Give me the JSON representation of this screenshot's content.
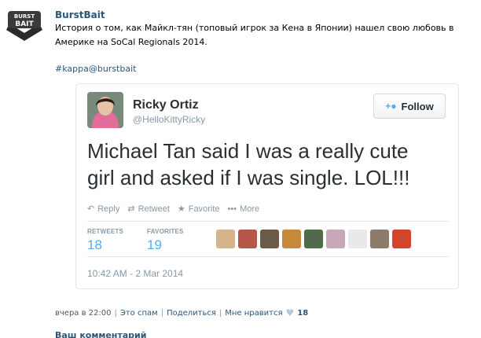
{
  "post": {
    "author": "BurstBait",
    "text": "История о том, как Майкл-тян (топовый игрок за Кена в Японии) нашел свою любовь в Америке на SoCal Regionals 2014.",
    "hashtag": "#kappa@burstbait",
    "logo_text": "BURST BAIT"
  },
  "tweet": {
    "name": "Ricky Ortiz",
    "handle": "@HelloKittyRicky",
    "follow_label": "Follow",
    "body": "Michael Tan said I was a really cute girl and asked if I was single. LOL!!!",
    "actions": [
      {
        "label": "Reply",
        "icon": "reply-icon"
      },
      {
        "label": "Retweet",
        "icon": "retweet-icon"
      },
      {
        "label": "Favorite",
        "icon": "star-icon"
      },
      {
        "label": "More",
        "icon": "more-icon"
      }
    ],
    "retweets_label": "RETWEETS",
    "retweets": "18",
    "favorites_label": "FAVORITES",
    "favorites": "19",
    "date": "10:42 AM - 2 Mar 2014",
    "accent": "#55acee"
  },
  "footer": {
    "time": "вчера в 22:00",
    "spam": "Это спам",
    "share": "Поделиться",
    "like": "Мне нравится",
    "like_count": "18",
    "comment_label": "Ваш комментарий"
  }
}
